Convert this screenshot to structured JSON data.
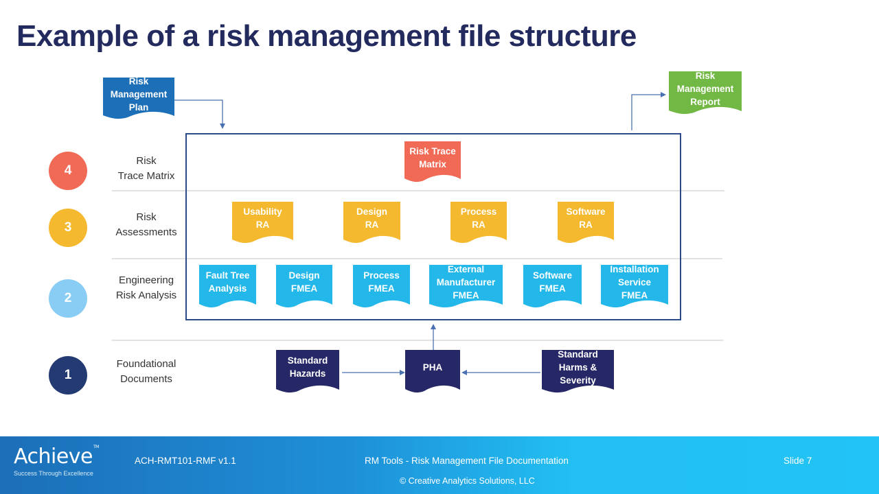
{
  "title": "Example of a risk management file structure",
  "colors": {
    "title": "#232a5e",
    "level4": "#f06a55",
    "level3": "#f4b92e",
    "level2": "#89cdf5",
    "level1": "#233a73",
    "trace_doc": "#f06a55",
    "ra_doc": "#f4b92e",
    "fmea_doc": "#24b8ea",
    "foundation_doc": "#262766",
    "plan_doc": "#1d6fb8",
    "report_doc": "#72b844",
    "box_border": "#2c4a8a",
    "connector": "#4b72b0",
    "divider": "#d9d9d9"
  },
  "top_docs": {
    "plan": "Risk\nManagement\nPlan",
    "report": "Risk\nManagement\nReport"
  },
  "levels": [
    {
      "number": "4",
      "label": "Risk\nTrace Matrix"
    },
    {
      "number": "3",
      "label": "Risk\nAssessments"
    },
    {
      "number": "2",
      "label": "Engineering\nRisk Analysis"
    },
    {
      "number": "1",
      "label": "Foundational\nDocuments"
    }
  ],
  "trace_docs": [
    "Risk Trace\nMatrix"
  ],
  "ra_docs": [
    "Usability\nRA",
    "Design\nRA",
    "Process\nRA",
    "Software\nRA"
  ],
  "fmea_docs": [
    "Fault Tree\nAnalysis",
    "Design\nFMEA",
    "Process\nFMEA",
    "External\nManufacturer\nFMEA",
    "Software\nFMEA",
    "Installation\nService\nFMEA"
  ],
  "foundation_docs": [
    "Standard\nHazards",
    "PHA",
    "Standard\nHarms &\nSeverity"
  ],
  "footer": {
    "logo_brand": "Achieve",
    "logo_tagline": "Success Through Excellence",
    "doc_id": "ACH-RMT101-RMF v1.1",
    "course": "RM Tools - Risk Management File Documentation",
    "slide": "Slide 7",
    "copyright": "© Creative Analytics Solutions, LLC"
  }
}
